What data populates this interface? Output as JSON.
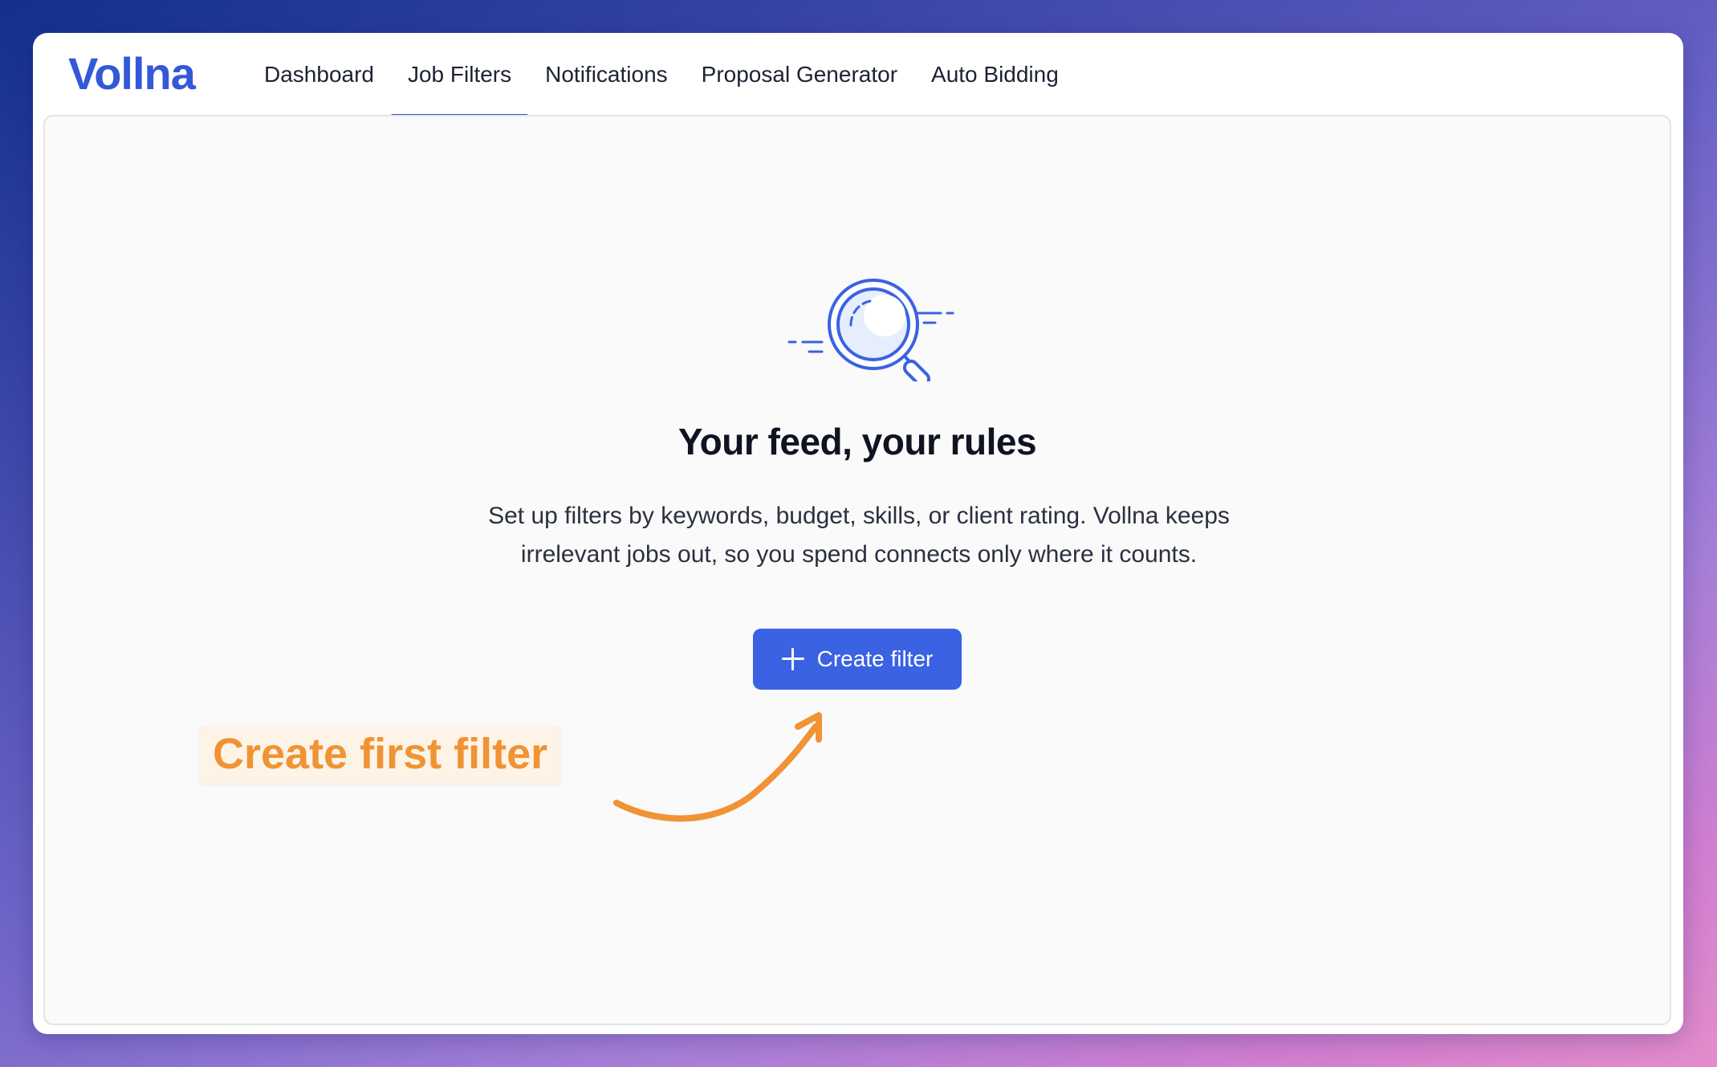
{
  "app": {
    "logo_text": "Vollna",
    "brand_color": "#3358d8"
  },
  "nav": {
    "tabs": [
      {
        "label": "Dashboard",
        "active": false
      },
      {
        "label": "Job Filters",
        "active": true
      },
      {
        "label": "Notifications",
        "active": false
      },
      {
        "label": "Proposal Generator",
        "active": false
      },
      {
        "label": "Auto Bidding",
        "active": false
      }
    ]
  },
  "empty_state": {
    "icon": "magnifier-icon",
    "title": "Your feed, your rules",
    "description_line1": "Set up filters by keywords, budget, skills, or client rating. Vollna keeps",
    "description_line2": "irrelevant jobs out, so you spend connects only where it counts.",
    "button_label": "Create filter",
    "button_icon": "plus-icon",
    "button_color": "#3a62e3"
  },
  "annotation": {
    "callout_text": "Create first filter",
    "callout_color": "#ef9335",
    "arrow_icon": "curved-arrow-icon"
  }
}
